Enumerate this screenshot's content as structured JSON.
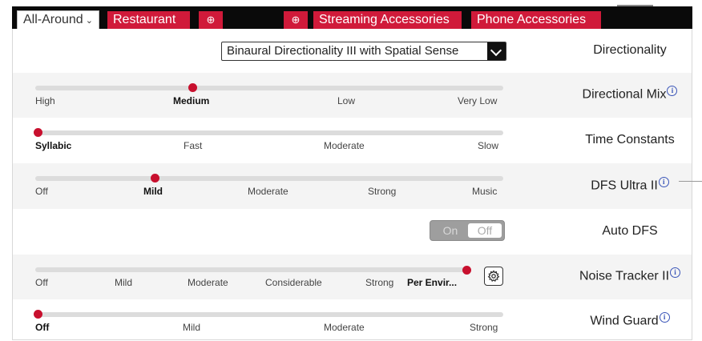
{
  "tabs": [
    {
      "label": "All-Around",
      "chevron": "⌄",
      "active": true
    },
    {
      "label": "Restaurant"
    },
    {
      "label": "⊕"
    },
    {
      "label": "⊕"
    },
    {
      "label": "Streaming Accessories"
    },
    {
      "label": "Phone Accessories"
    }
  ],
  "icons": {
    "info": "info-icon",
    "gear": "gear-icon",
    "caret": "chevron-down-icon",
    "add": "add-icon"
  },
  "colors": {
    "accent": "#d01a3a",
    "knob": "#c8102e",
    "tabbar": "#0a0a0a",
    "info": "#3a55b8"
  },
  "directionality": {
    "label": "Directionality",
    "selected": "Binaural Directionality III with Spatial Sense"
  },
  "directional_mix": {
    "label": "Directional Mix",
    "info": "i",
    "stops": [
      "High",
      "Medium",
      "Low",
      "Very Low"
    ],
    "selected": "Medium"
  },
  "time_constants": {
    "label": "Time Constants",
    "stops": [
      "Syllabic",
      "Fast",
      "Moderate",
      "Slow"
    ],
    "selected": "Syllabic"
  },
  "dfs_ultra": {
    "label": "DFS Ultra II",
    "info": "i",
    "stops": [
      "Off",
      "Mild",
      "Moderate",
      "Strong",
      "Music"
    ],
    "selected": "Mild"
  },
  "auto_dfs": {
    "label": "Auto DFS",
    "on_label": "On",
    "off_label": "Off",
    "state": "Off"
  },
  "noise_tracker": {
    "label": "Noise Tracker II",
    "info": "i",
    "stops": [
      "Off",
      "Mild",
      "Moderate",
      "Considerable",
      "Strong",
      "Per Envir..."
    ],
    "selected": "Per Envir..."
  },
  "wind_guard": {
    "label": "Wind Guard",
    "info": "i",
    "stops": [
      "Off",
      "Mild",
      "Moderate",
      "Strong"
    ],
    "selected": "Off"
  }
}
